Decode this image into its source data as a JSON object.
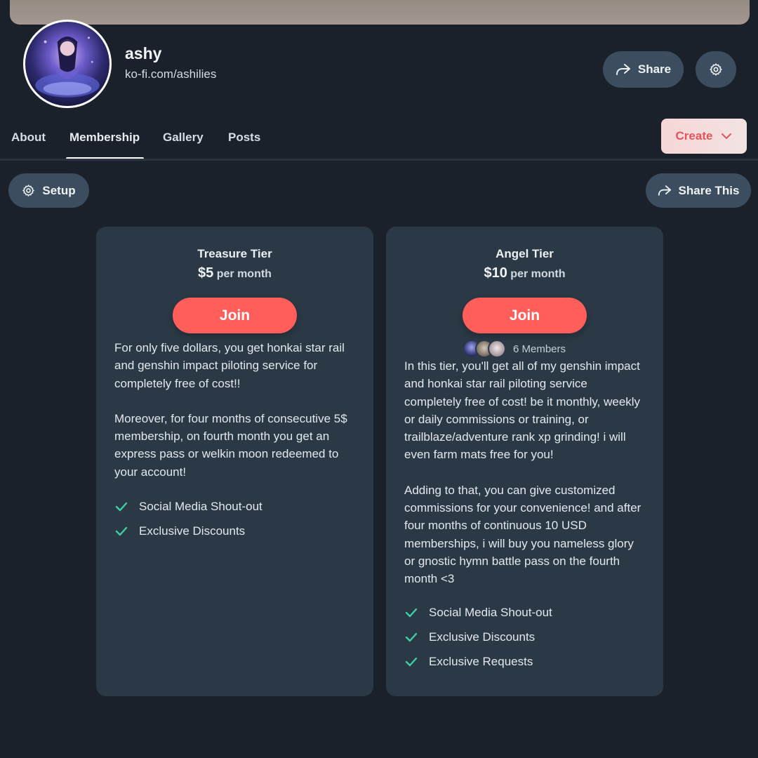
{
  "profile": {
    "name": "ashy",
    "url": "ko-fi.com/ashilies"
  },
  "header_actions": {
    "share_label": "Share",
    "settings_icon": "gear-icon"
  },
  "nav": {
    "tabs": [
      {
        "label": "About"
      },
      {
        "label": "Membership",
        "active": true
      },
      {
        "label": "Gallery"
      },
      {
        "label": "Posts"
      }
    ],
    "create_label": "Create"
  },
  "toolbar": {
    "setup_label": "Setup",
    "share_this_label": "Share This"
  },
  "tiers": [
    {
      "name": "Treasure Tier",
      "price": "$5",
      "period": "per month",
      "join_label": "Join",
      "description": [
        "For only five dollars, you get honkai star rail and genshin impact piloting service for completely free of cost!!",
        "Moreover, for four months of consecutive 5$ membership, on fourth month you get an express pass or welkin moon redeemed to your account!"
      ],
      "benefits": [
        "Social Media Shout-out",
        "Exclusive Discounts"
      ]
    },
    {
      "name": "Angel Tier",
      "price": "$10",
      "period": "per month",
      "join_label": "Join",
      "members_label": "6 Members",
      "description": [
        "In this tier, you'll get all of my genshin impact and honkai star rail piloting service completely free of cost! be it monthly, weekly or daily commissions or training, or trailblaze/adventure rank xp grinding! i will even farm mats free for you!",
        "Adding to that, you can give customized commissions for your convenience! and after four months of continuous 10 USD memberships, i will buy you nameless glory or gnostic hymn battle pass on the fourth month <3"
      ],
      "benefits": [
        "Social Media Shout-out",
        "Exclusive Discounts",
        "Exclusive Requests"
      ]
    }
  ],
  "colors": {
    "background": "#1b212a",
    "card": "#2b3946",
    "button": "#3b4d5e",
    "accent": "#ff5e5b",
    "check": "#3ecfa5",
    "create_text": "#e5535a"
  }
}
